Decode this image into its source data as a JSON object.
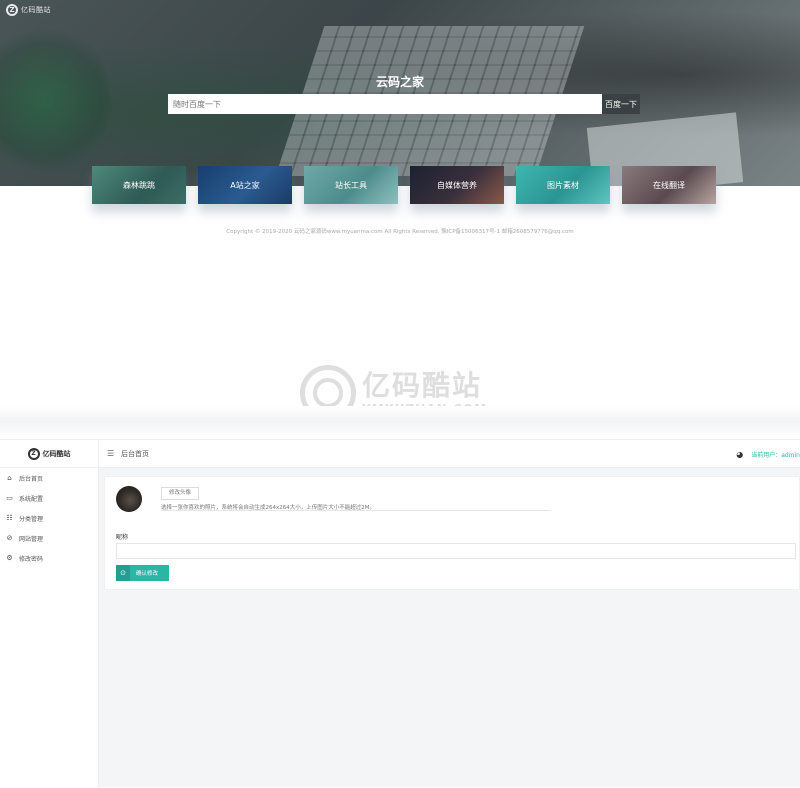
{
  "homepage": {
    "logo_text": "亿码酷站",
    "title": "云码之家",
    "search": {
      "placeholder": "随时百度一下",
      "button_label": "百度一下"
    },
    "cards": [
      {
        "label": "森林跳跳"
      },
      {
        "label": "A站之家"
      },
      {
        "label": "站长工具"
      },
      {
        "label": "自媒体营养"
      },
      {
        "label": "图片素材"
      },
      {
        "label": "在线翻译"
      }
    ],
    "copyright": "Copyright © 2019-2020 云码之家源码www.myuanma.com All Rights Reserved. 豫ICP备15006317号-1 邮箱2608579776@qq.com"
  },
  "watermark": {
    "cn": "亿码酷站",
    "en": "YMKUZHAN.COM"
  },
  "admin": {
    "sidebar": {
      "logo_text": "亿码酷站",
      "items": [
        {
          "label": "后台首页",
          "icon": "home-icon"
        },
        {
          "label": "系统配置",
          "icon": "monitor-icon"
        },
        {
          "label": "分类管理",
          "icon": "grid-icon"
        },
        {
          "label": "网站管理",
          "icon": "link-icon"
        },
        {
          "label": "修改密码",
          "icon": "gear-icon"
        }
      ]
    },
    "topbar": {
      "breadcrumb": "后台首页",
      "user_text": "当前用户：admin"
    },
    "profile": {
      "edit_avatar_label": "修改头像",
      "avatar_hint": "选择一张你喜欢的照片，系统将会自动生成264x264大小，上传图片大小不能超过2M。",
      "nickname_label": "昵称",
      "nickname_value": "",
      "confirm_label": "确认修改"
    }
  },
  "colors": {
    "accent": "#2ab5a5",
    "dark_button": "#3a4043"
  }
}
